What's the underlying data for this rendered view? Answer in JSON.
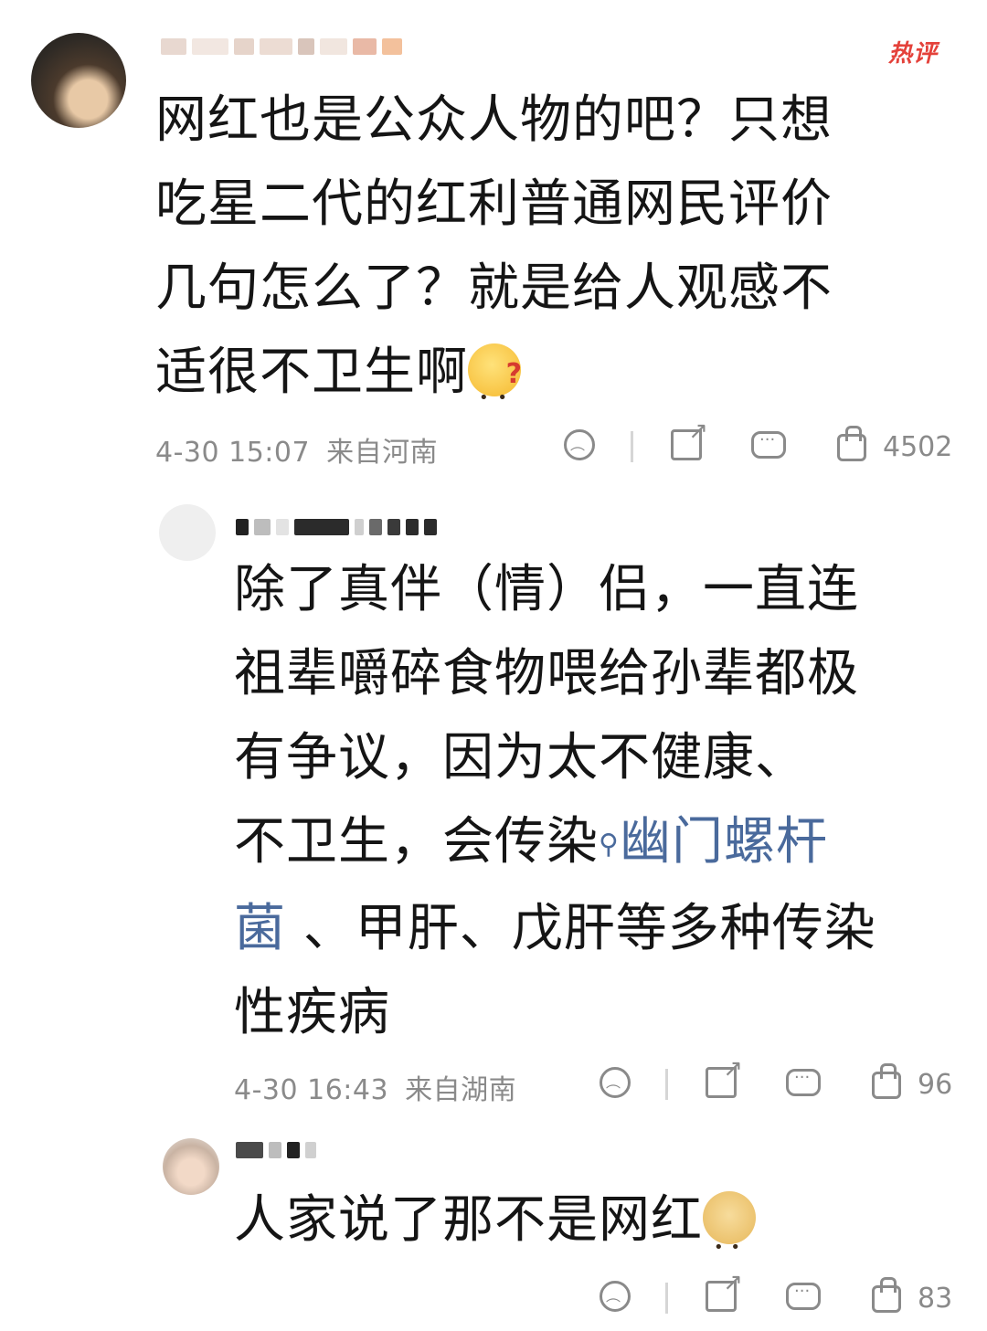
{
  "badge": {
    "hot": "热评"
  },
  "comments": [
    {
      "username": "",
      "text_lines": [
        "网红也是公众人物的吧？只想",
        "吃星二代的红利普通网民评价",
        "几句怎么了？就是给人观感不",
        "适很不卫生啊"
      ],
      "emoji": "thinking-emoji",
      "timestamp": "4-30 15:07",
      "location": "来自河南",
      "likes": "4502"
    },
    {
      "username": "",
      "text_lines": [
        "除了真伴（情）侣，一直连",
        "祖辈嚼碎食物喂给孙辈都极",
        "有争议，因为太不健康、"
      ],
      "line4_prefix": "不卫生，会传染",
      "link_line4": "幽门螺杆",
      "link_line5": "菌",
      "line5_suffix": " 、甲肝、戊肝等多种传染",
      "line6": "性疾病",
      "timestamp": "4-30 16:43",
      "location": "来自湖南",
      "likes": "96"
    },
    {
      "username": "",
      "text": "人家说了那不是网红",
      "emoji": "doge-emoji",
      "likes": "83"
    }
  ],
  "icons": [
    "dislike-icon",
    "share-icon",
    "comment-icon",
    "like-icon",
    "search-icon"
  ],
  "colors": {
    "link": "#4a6a9c",
    "meta": "#8a8a8a",
    "hot": "#e4413a"
  }
}
